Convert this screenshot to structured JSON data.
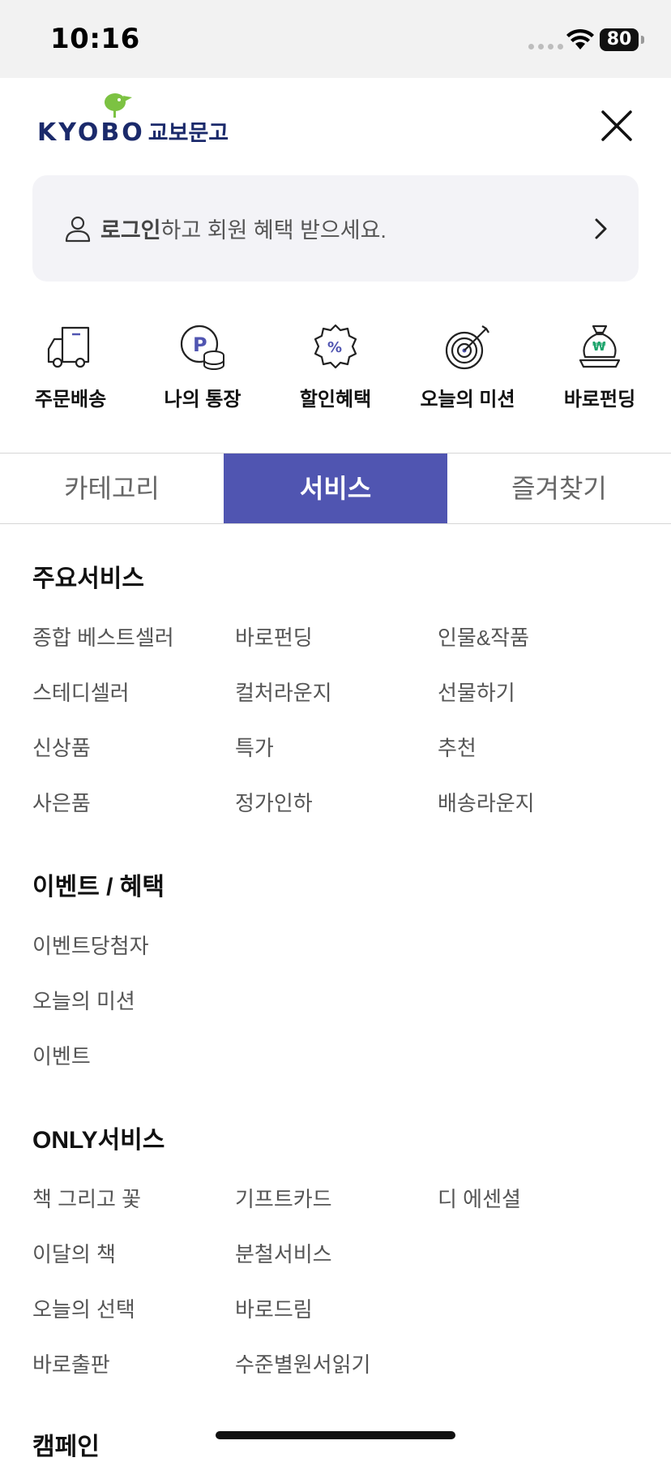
{
  "status_bar": {
    "time": "10:16",
    "battery": "80"
  },
  "header": {
    "logo_text": "KYOBO",
    "logo_korean": "교보문고"
  },
  "login_card": {
    "bold": "로그인",
    "rest": "하고 회원 혜택 받으세요."
  },
  "quick_menu": [
    {
      "label": "주문배송",
      "icon": "delivery-truck-icon"
    },
    {
      "label": "나의 통장",
      "icon": "point-coins-icon"
    },
    {
      "label": "할인혜택",
      "icon": "discount-badge-icon"
    },
    {
      "label": "오늘의 미션",
      "icon": "target-icon"
    },
    {
      "label": "바로펀딩",
      "icon": "money-bag-icon"
    }
  ],
  "tabs": [
    {
      "label": "카테고리",
      "active": false
    },
    {
      "label": "서비스",
      "active": true
    },
    {
      "label": "즐겨찾기",
      "active": false
    }
  ],
  "sections": {
    "main": {
      "title": "주요서비스",
      "items": [
        "종합 베스트셀러",
        "바로펀딩",
        "인물&작품",
        "스테디셀러",
        "컬처라운지",
        "선물하기",
        "신상품",
        "특가",
        "추천",
        "사은품",
        "정가인하",
        "배송라운지"
      ]
    },
    "event": {
      "title": "이벤트 / 혜택",
      "items": [
        "이벤트당첨자",
        "오늘의 미션",
        "이벤트"
      ]
    },
    "only": {
      "title": "ONLY서비스",
      "items": [
        "책 그리고 꽃",
        "기프트카드",
        "디 에센셜",
        "이달의 책",
        "분철서비스",
        "오늘의 선택",
        "바로드림",
        "바로출판",
        "수준별원서읽기"
      ]
    },
    "campaign": {
      "title": "캠페인"
    }
  },
  "colors": {
    "accent": "#5055b1",
    "logo": "#1b2a6b",
    "logo_bird": "#7cc242"
  }
}
